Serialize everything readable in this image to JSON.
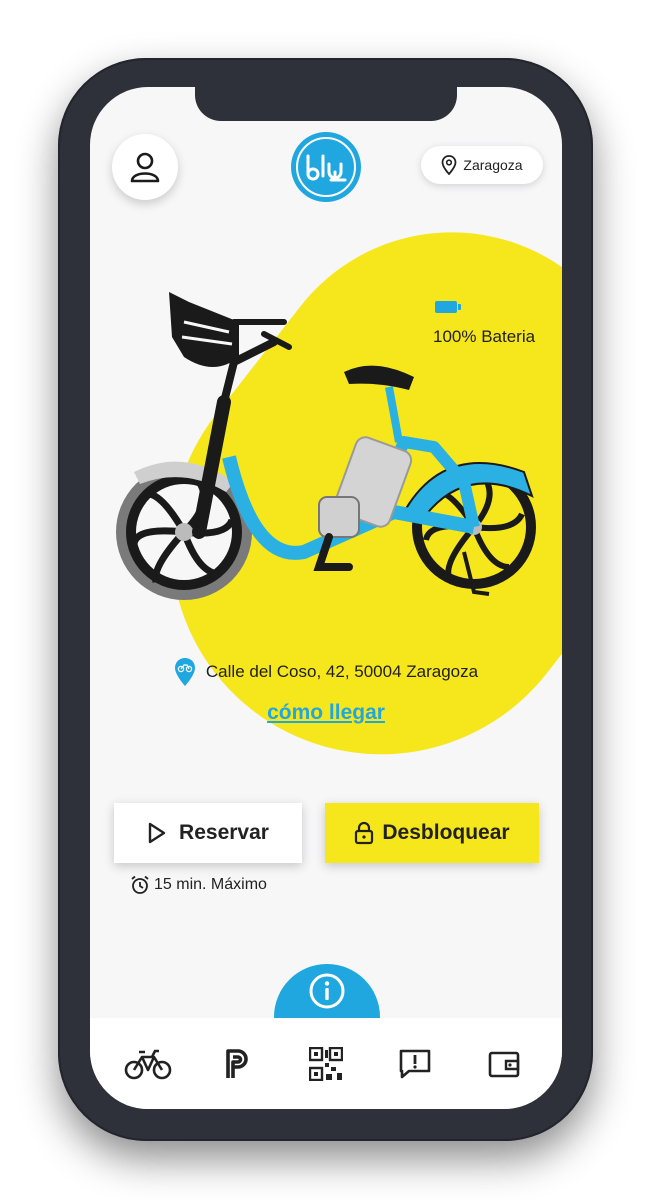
{
  "header": {
    "city": "Zaragoza",
    "logo_text": "blu"
  },
  "bike": {
    "battery_label": "100% Bateria",
    "battery_level": 1.0,
    "address": "Calle del Coso, 42, 50004 Zaragoza",
    "route_link": "cómo llegar"
  },
  "actions": {
    "reserve_label": "Reservar",
    "unlock_label": "Desbloquear",
    "max_time": "15 min. Máximo"
  },
  "nav": {
    "items": [
      "bike-icon",
      "parking-icon",
      "qr-code-icon",
      "report-icon",
      "wallet-icon"
    ]
  },
  "colors": {
    "brand_blue": "#21a7df",
    "brand_yellow": "#f6e71c",
    "frame": "#2e303a"
  }
}
